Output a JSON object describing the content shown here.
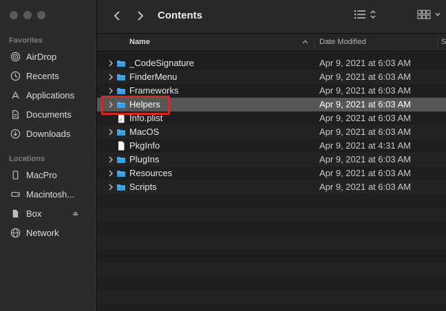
{
  "sidebar": {
    "favorites_title": "Favorites",
    "favorites": [
      {
        "label": "AirDrop",
        "icon": "airdrop-icon"
      },
      {
        "label": "Recents",
        "icon": "clock-icon"
      },
      {
        "label": "Applications",
        "icon": "applications-icon"
      },
      {
        "label": "Documents",
        "icon": "document-icon"
      },
      {
        "label": "Downloads",
        "icon": "download-icon"
      }
    ],
    "locations_title": "Locations",
    "locations": [
      {
        "label": "MacPro",
        "icon": "phone-device-icon"
      },
      {
        "label": "Macintosh...",
        "icon": "hard-drive-icon"
      },
      {
        "label": "Box",
        "icon": "drive-icon"
      },
      {
        "label": "Network",
        "icon": "globe-icon"
      }
    ]
  },
  "toolbar": {
    "title": "Contents"
  },
  "columns": {
    "name": "Name",
    "date": "Date Modified",
    "size": "S"
  },
  "files": [
    {
      "name": "_CodeSignature",
      "date": "Apr 9, 2021 at 6:03 AM",
      "type": "folder"
    },
    {
      "name": "FinderMenu",
      "date": "Apr 9, 2021 at 6:03 AM",
      "type": "folder"
    },
    {
      "name": "Frameworks",
      "date": "Apr 9, 2021 at 6:03 AM",
      "type": "folder"
    },
    {
      "name": "Helpers",
      "date": "Apr 9, 2021 at 6:03 AM",
      "type": "folder",
      "selected": true
    },
    {
      "name": "Info.plist",
      "date": "Apr 9, 2021 at 6:03 AM",
      "type": "plist"
    },
    {
      "name": "MacOS",
      "date": "Apr 9, 2021 at 6:03 AM",
      "type": "folder"
    },
    {
      "name": "PkgInfo",
      "date": "Apr 9, 2021 at 4:31 AM",
      "type": "file"
    },
    {
      "name": "PlugIns",
      "date": "Apr 9, 2021 at 6:03 AM",
      "type": "folder"
    },
    {
      "name": "Resources",
      "date": "Apr 9, 2021 at 6:03 AM",
      "type": "folder"
    },
    {
      "name": "Scripts",
      "date": "Apr 9, 2021 at 6:03 AM",
      "type": "folder"
    }
  ],
  "colors": {
    "folder": "#3d9ce6",
    "highlight": "#e0241b",
    "selected_row": "#575757"
  }
}
